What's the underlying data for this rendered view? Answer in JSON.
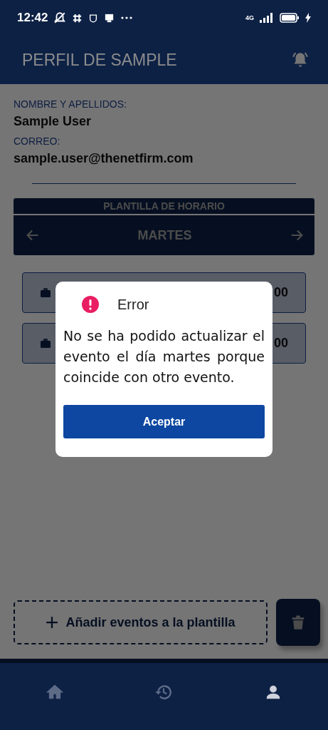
{
  "status_bar": {
    "time": "12:42",
    "network": "4G"
  },
  "header": {
    "title": "PERFIL DE SAMPLE"
  },
  "profile": {
    "name_label": "NOMBRE Y APELLIDOS:",
    "name": "Sample User",
    "email_label": "CORREO:",
    "email": "sample.user@thenetfirm.com"
  },
  "schedule": {
    "title": "PLANTILLA DE HORARIO",
    "day": "MARTES"
  },
  "events": [
    {
      "time": "00"
    },
    {
      "time": "00"
    }
  ],
  "add_button": {
    "label": "Añadir eventos a la plantilla"
  },
  "bottom_nav": [
    {
      "kind": "home",
      "selected": false
    },
    {
      "kind": "history",
      "selected": false
    },
    {
      "kind": "profile",
      "selected": true
    }
  ],
  "dialog": {
    "title": "Error",
    "message": "No se ha podido actualizar el evento el día martes porque coincide con otro evento.",
    "button": "Aceptar"
  }
}
